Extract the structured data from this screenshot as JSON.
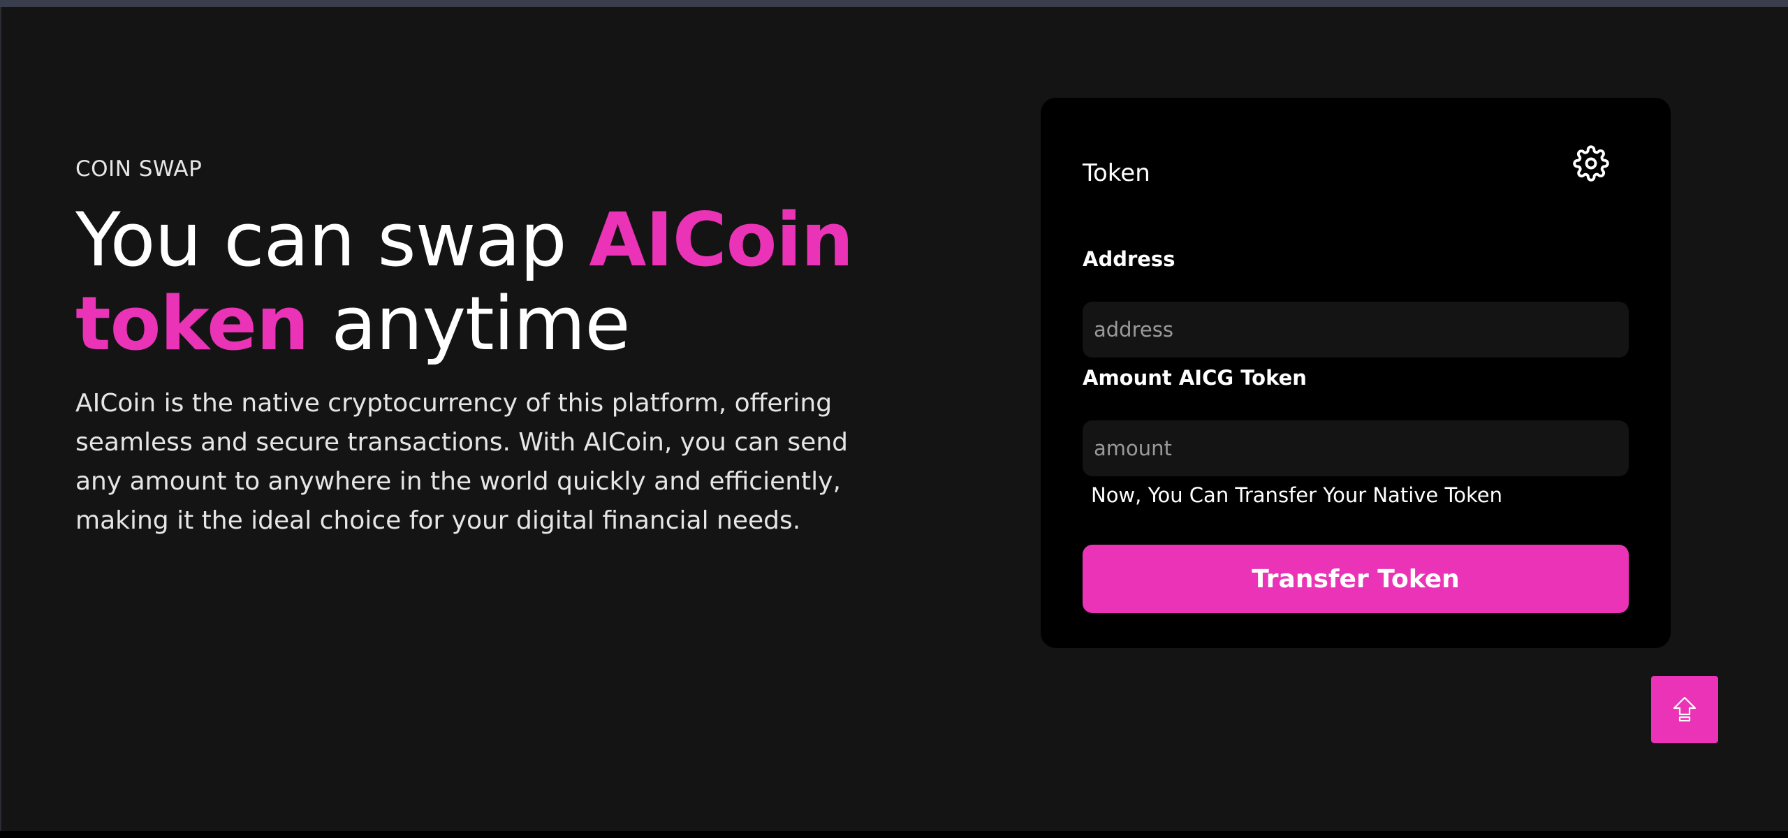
{
  "hero": {
    "eyebrow": "COIN SWAP",
    "headline_part1": "You can swap ",
    "headline_accent1": "AICoin",
    "headline_accent2": "token",
    "headline_part2": " anytime",
    "description": "AICoin is the native cryptocurrency of this platform, offering seamless and secure transactions. With AICoin, you can send any amount to anywhere in the world quickly and efficiently, making it the ideal choice for your digital financial needs."
  },
  "swap_card": {
    "title": "Token",
    "settings_icon": "gear-icon",
    "address_label": "Address",
    "address_placeholder": "address",
    "address_value": "",
    "amount_label": "Amount AICG Token",
    "amount_placeholder": "amount",
    "amount_value": "",
    "hint": "Now, You Can Transfer Your Native Token",
    "submit_label": "Transfer Token"
  },
  "scroll_top": {
    "icon": "arrow-up-icon"
  },
  "colors": {
    "accent": "#ea33b6",
    "background": "#141414",
    "card_background": "#000000",
    "input_background": "#141414"
  }
}
